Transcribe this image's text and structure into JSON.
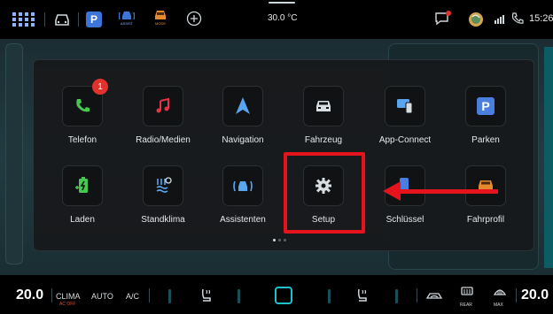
{
  "status": {
    "temperature": "30.0 °C",
    "time": "15:26",
    "icons": [
      "apps-grid-icon",
      "car-icon",
      "parking-icon",
      "assist-icon",
      "mode-icon",
      "add-icon",
      "message-icon",
      "user-icon",
      "signal-icon",
      "phone-icon"
    ],
    "assist_label": "ASSIST",
    "mode_label": "MODE",
    "parking_label": "P"
  },
  "launcher": {
    "apps": [
      {
        "label": "Telefon",
        "icon": "phone-icon",
        "badge": "1"
      },
      {
        "label": "Radio/Medien",
        "icon": "music-note-icon"
      },
      {
        "label": "Navigation",
        "icon": "navigation-arrow-icon"
      },
      {
        "label": "Fahrzeug",
        "icon": "car-front-icon"
      },
      {
        "label": "App-Connect",
        "icon": "app-connect-icon"
      },
      {
        "label": "Parken",
        "icon": "parking-icon",
        "glyph": "P"
      },
      {
        "label": "Laden",
        "icon": "charging-icon"
      },
      {
        "label": "Standklima",
        "icon": "climate-icon"
      },
      {
        "label": "Assistenten",
        "icon": "assist-icon"
      },
      {
        "label": "Setup",
        "icon": "gear-icon"
      },
      {
        "label": "Schlüssel",
        "icon": "key-icon"
      },
      {
        "label": "Fahrprofil",
        "icon": "drive-profile-icon"
      }
    ],
    "page_count": 3,
    "current_page": 1
  },
  "bottom": {
    "left_temp": "20.0",
    "clima": "CLIMA",
    "clima_sub": "AC OFF",
    "auto": "AUTO",
    "ac": "A/C",
    "rear": "REAR",
    "max": "MAX",
    "right_temp": "20.0"
  },
  "colors": {
    "accent": "#20c0cc",
    "annotation": "#e5131c",
    "badge": "#e0322c"
  }
}
